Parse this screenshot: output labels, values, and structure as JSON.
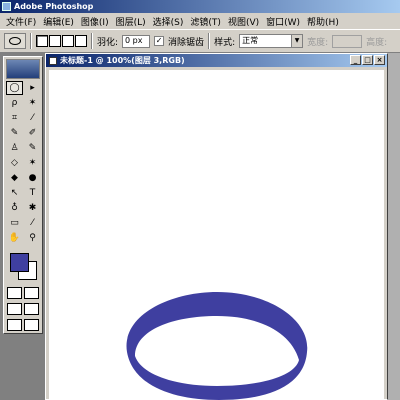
{
  "app": {
    "title": "Adobe Photoshop"
  },
  "menu": [
    "文件(F)",
    "编辑(E)",
    "图像(I)",
    "图层(L)",
    "选择(S)",
    "滤镜(T)",
    "视图(V)",
    "窗口(W)",
    "帮助(H)"
  ],
  "options": {
    "feather_label": "羽化:",
    "feather_value": "0 px",
    "antialias_label": "消除锯齿",
    "antialias_check": "✓",
    "style_label": "样式:",
    "style_value": "正常",
    "width_label": "宽度:",
    "height_label": "高度:"
  },
  "document": {
    "title": "未标题-1 @ 100%(图层 3,RGB)"
  },
  "colors": {
    "foreground": "#3f3fa0",
    "background": "#ffffff",
    "ellipse": "#3f3fa0"
  },
  "tools": {
    "labels": [
      "◯",
      "▸",
      "ρ",
      "✶",
      "⌗",
      "⁄",
      "✎",
      "✐",
      "♙",
      "✎",
      "◇",
      "✶",
      "◆",
      "●",
      "↖",
      "T",
      "♁",
      "✱",
      "▭",
      "⁄",
      "✋",
      "⚲"
    ]
  }
}
